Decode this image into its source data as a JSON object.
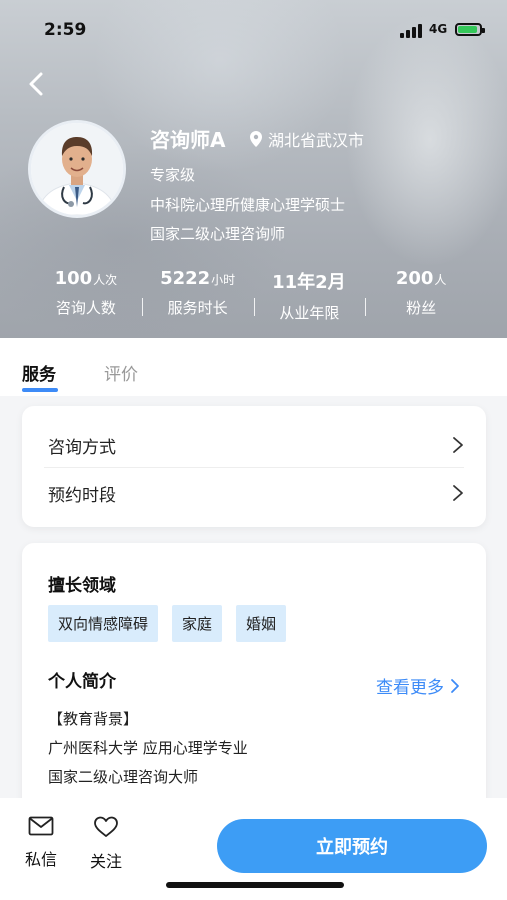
{
  "status_bar": {
    "time": "2:59",
    "network": "4G"
  },
  "profile": {
    "name": "咨询师A",
    "location": "湖北省武汉市",
    "level": "专家级",
    "education": "中科院心理所健康心理学硕士",
    "certificate": "国家二级心理咨询师"
  },
  "stats": [
    {
      "value": "100",
      "unit": "人次",
      "label": "咨询人数"
    },
    {
      "value": "5222",
      "unit": "小时",
      "label": "服务时长"
    },
    {
      "value": "11年2月",
      "unit": "",
      "label": "从业年限"
    },
    {
      "value": "200",
      "unit": "人",
      "label": "粉丝"
    }
  ],
  "tabs": {
    "service": "服务",
    "review": "评价"
  },
  "service_rows": {
    "method": "咨询方式",
    "schedule": "预约时段"
  },
  "expertise": {
    "title": "擅长领域",
    "tags": [
      "双向情感障碍",
      "家庭",
      "婚姻"
    ]
  },
  "intro": {
    "title": "个人简介",
    "more": "查看更多",
    "edu_header": "【教育背景】",
    "line1": "广州医科大学 应用心理学专业",
    "line2": "国家二级心理咨询大师"
  },
  "bottom_bar": {
    "message": "私信",
    "follow": "关注",
    "book": "立即预约"
  },
  "colors": {
    "accent": "#3d8bf7",
    "button": "#3d9df5",
    "tag_bg": "#d9ecfc"
  }
}
